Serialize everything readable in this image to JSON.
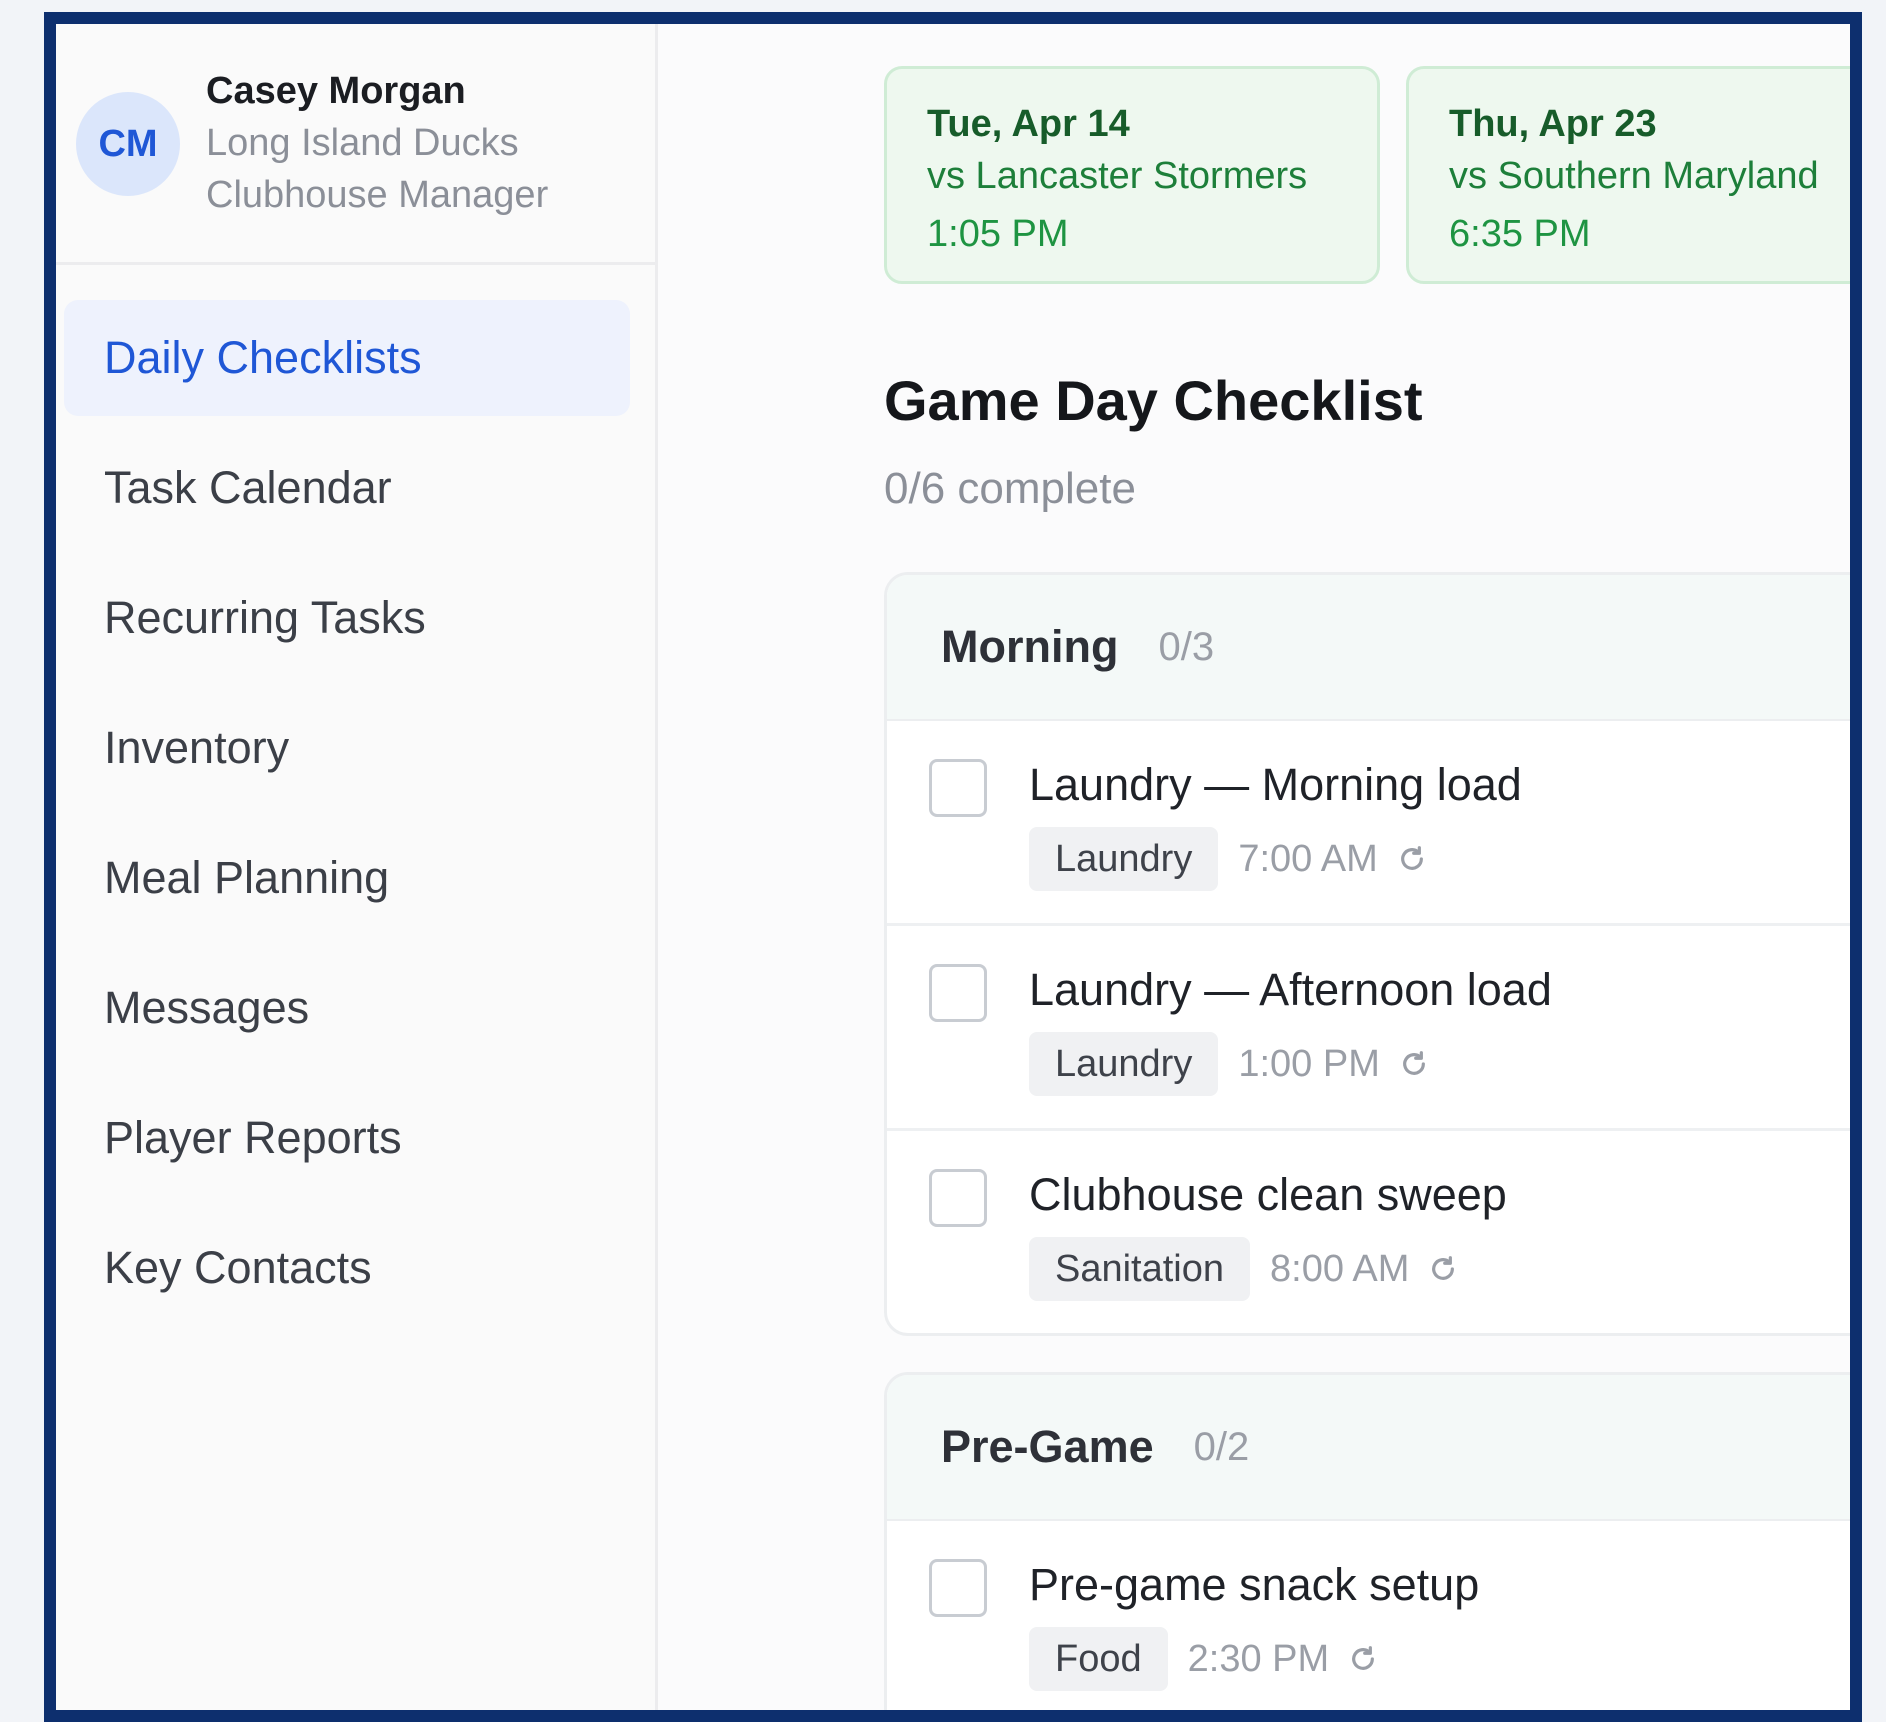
{
  "profile": {
    "initials": "CM",
    "name": "Casey Morgan",
    "team": "Long Island Ducks",
    "role": "Clubhouse Manager"
  },
  "nav": {
    "items": [
      {
        "label": "Daily Checklists",
        "active": true
      },
      {
        "label": "Task Calendar"
      },
      {
        "label": "Recurring Tasks"
      },
      {
        "label": "Inventory"
      },
      {
        "label": "Meal Planning"
      },
      {
        "label": "Messages"
      },
      {
        "label": "Player Reports"
      },
      {
        "label": "Key Contacts"
      }
    ]
  },
  "games": [
    {
      "date": "Tue, Apr 14",
      "opponent": "vs Lancaster Stormers",
      "time": "1:05 PM"
    },
    {
      "date": "Thu, Apr 23",
      "opponent": "vs Southern Maryland",
      "time": "6:35 PM"
    }
  ],
  "checklist": {
    "title": "Game Day Checklist",
    "progress": "0/6 complete"
  },
  "sections": [
    {
      "title": "Morning",
      "count": "0/3",
      "tasks": [
        {
          "title": "Laundry — Morning load",
          "tag": "Laundry",
          "time": "7:00 AM",
          "icon": "repeat-icon"
        },
        {
          "title": "Laundry — Afternoon load",
          "tag": "Laundry",
          "time": "1:00 PM",
          "icon": "repeat-icon"
        },
        {
          "title": "Clubhouse clean sweep",
          "tag": "Sanitation",
          "time": "8:00 AM",
          "icon": "repeat-icon"
        }
      ]
    },
    {
      "title": "Pre-Game",
      "count": "0/2",
      "tasks": [
        {
          "title": "Pre-game snack setup",
          "tag": "Food",
          "time": "2:30 PM",
          "icon": "repeat-icon"
        }
      ]
    }
  ],
  "colors": {
    "frame": "#0d2f6e",
    "accent": "#1f57d6",
    "game_card_bg": "#eef8ef",
    "game_text": "#175c2a"
  }
}
